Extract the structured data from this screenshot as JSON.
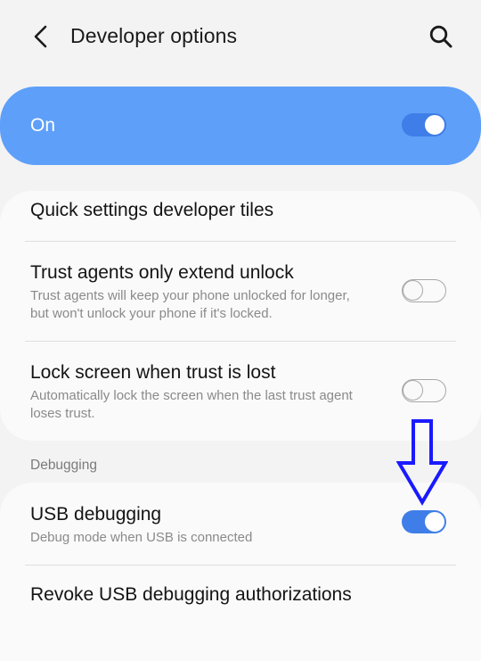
{
  "header": {
    "title": "Developer options",
    "back_icon": "chevron-left-icon",
    "search_icon": "search-icon"
  },
  "master_switch": {
    "label": "On",
    "state": "on",
    "background_color": "#5e9ff9"
  },
  "settings": [
    {
      "title": "Quick settings developer tiles"
    },
    {
      "title": "Trust agents only extend unlock",
      "subtitle": "Trust agents will keep your phone unlocked for longer, but won't unlock your phone if it's locked.",
      "toggle": "off"
    },
    {
      "title": "Lock screen when trust is lost",
      "subtitle": "Automatically lock the screen when the last trust agent loses trust.",
      "toggle": "off"
    }
  ],
  "debugging": {
    "header": "Debugging",
    "items": [
      {
        "title": "USB debugging",
        "subtitle": "Debug mode when USB is connected",
        "toggle": "on"
      },
      {
        "title": "Revoke USB debugging authorizations"
      }
    ]
  },
  "annotation": {
    "icon": "down-arrow-annotation-icon",
    "color": "#1a1aff"
  },
  "colors": {
    "toggle_on": "#3f7ee8",
    "toggle_off_border": "#a8a8a8",
    "background": "#f3f3f3",
    "card": "#fafafa"
  }
}
